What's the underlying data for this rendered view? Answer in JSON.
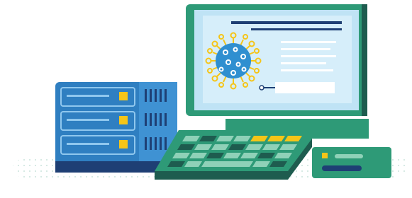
{
  "illustration": {
    "subject": "",
    "colors": {
      "ground_dots": "#c9e4dc",
      "server_body": "#2f7fc1",
      "server_panel": "#3f92d3",
      "server_slot": "#8fc7ee",
      "server_led": "#f5c518",
      "server_base": "#1e3f74",
      "monitor_frame": "#2e9a77",
      "monitor_screen": "#bfe3f5",
      "monitor_text_line": "#1e3f74",
      "virus_body": "#2f8fd0",
      "virus_spikes": "#f5c518",
      "keyboard_body": "#2e9a77",
      "keyboard_key": "#8fd1b8",
      "keyboard_key_dark": "#1e5c4f",
      "keyboard_key_yellow": "#f5c518",
      "tower_body": "#2e9a77",
      "tower_slot": "#1e3f74"
    }
  }
}
